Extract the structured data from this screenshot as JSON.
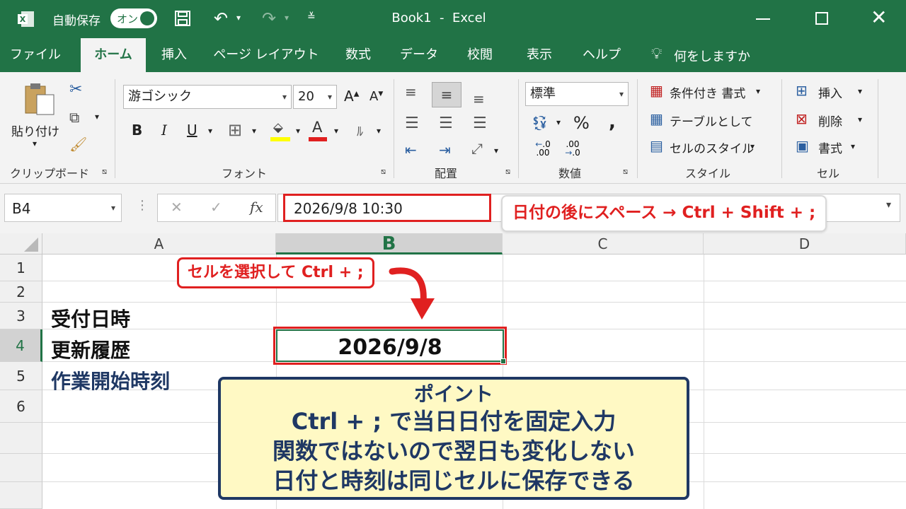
{
  "titlebar": {
    "autosave_label": "自動保存",
    "autosave_toggle": "オン",
    "window_title": "Book1  -  Excel"
  },
  "tabs": [
    "ファイル",
    "ホーム",
    "挿入",
    "ページ レイアウト",
    "数式",
    "データ",
    "校閲",
    "表示",
    "ヘルプ"
  ],
  "tell_me": "何をしますか",
  "ribbon": {
    "clipboard": {
      "paste": "貼り付け",
      "group": "クリップボード"
    },
    "font": {
      "name": "游ゴシック",
      "size": "20",
      "bold": "B",
      "italic": "I",
      "underline": "U",
      "group": "フォント"
    },
    "alignment": {
      "group": "配置"
    },
    "number": {
      "format": "標準",
      "percent": "%",
      "comma": ",",
      "inc_decimal": ".00",
      "dec_decimal": ".0",
      "group": "数値"
    },
    "styles": {
      "conditional": "条件付き 書式",
      "table": "テーブルとして",
      "cell_styles": "セルのスタイル",
      "group": "スタイル"
    },
    "cells": {
      "insert": "挿入",
      "delete": "削除",
      "format": "書式",
      "group": "セル"
    }
  },
  "formula_bar": {
    "name_box": "B4",
    "fx": "fx",
    "content": "2026/9/8 10:30"
  },
  "columns": [
    "A",
    "B",
    "C",
    "D"
  ],
  "rows": [
    "1",
    "2",
    "3",
    "4",
    "5",
    "6"
  ],
  "cells": {
    "a3": "受付日時",
    "a4": "更新履歴",
    "a5": "作業開始時刻",
    "b4": "2026/9/8"
  },
  "callouts": {
    "select_cell": "セルを選択して Ctrl + ;",
    "after_date": "日付の後にスペース → Ctrl + Shift + ;"
  },
  "point_box": {
    "title": "ポイント",
    "lines": [
      "Ctrl + ; で当日日付を固定入力",
      "関数ではないので翌日も変化しない",
      "日付と時刻は同じセルに保存できる"
    ]
  },
  "colors": {
    "excel_green": "#217346",
    "callout_red": "#e02020",
    "point_bg": "#fff9c4",
    "point_border": "#1f3864"
  }
}
